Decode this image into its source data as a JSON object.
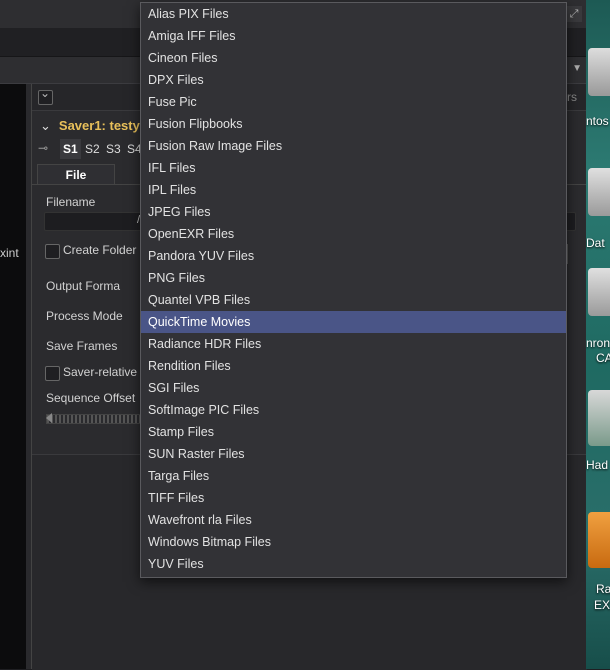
{
  "viewer": {
    "clip_text": "xint"
  },
  "inspector": {
    "header_right": "rs",
    "tool_title": "Saver1: testy",
    "tool_arrow": "⌄",
    "pin_icon": "pin-icon",
    "slots": [
      "S1",
      "S2",
      "S3",
      "S4"
    ],
    "active_slot": "S1",
    "tab_label": "File",
    "filename_label": "Filename",
    "filename_value": "/",
    "create_folder_label": "Create Folder",
    "output_format_label": "Output Forma",
    "process_mode_label": "Process Mode",
    "save_frames_label": "Save Frames",
    "saver_relative_label": "Saver-relative",
    "sequence_offset_label": "Sequence Offset"
  },
  "format_menu": {
    "items": [
      "Alias PIX Files",
      "Amiga IFF Files",
      "Cineon Files",
      "DPX Files",
      "Fuse Pic",
      "Fusion Flipbooks",
      "Fusion Raw Image Files",
      "IFL Files",
      "IPL Files",
      "JPEG Files",
      "OpenEXR Files",
      "Pandora YUV Files",
      "PNG Files",
      "Quantel VPB Files",
      "QuickTime Movies",
      "Radiance HDR Files",
      "Rendition Files",
      "SGI Files",
      "SoftImage PIC Files",
      "Stamp Files",
      "SUN Raster Files",
      "Targa Files",
      "TIFF Files",
      "Wavefront rla Files",
      "Windows Bitmap Files",
      "YUV Files"
    ],
    "selected_index": 14,
    "highlight_color": "#4a5587"
  },
  "desktop": {
    "icons": [
      {
        "label": "ntos"
      },
      {
        "label": "Dat"
      },
      {
        "label": "nron"
      },
      {
        "label": "CA"
      },
      {
        "label": "Had"
      },
      {
        "label": "Ra"
      },
      {
        "label": "EX"
      }
    ]
  }
}
